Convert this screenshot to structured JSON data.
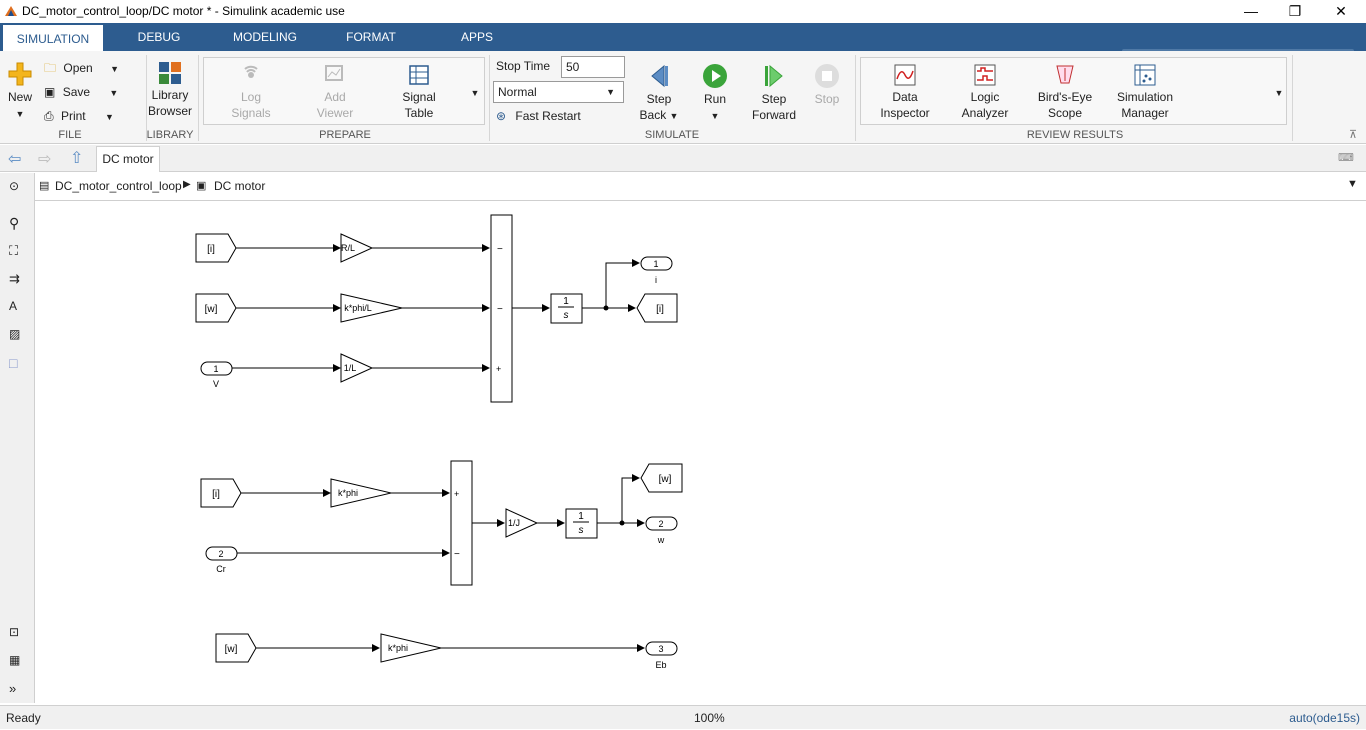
{
  "window": {
    "title": "DC_motor_control_loop/DC motor * - Simulink academic use",
    "minimize": "—",
    "restore": "❐",
    "close": "✕"
  },
  "tabs": [
    {
      "label": "SIMULATION"
    },
    {
      "label": "DEBUG"
    },
    {
      "label": "MODELING"
    },
    {
      "label": "FORMAT"
    },
    {
      "label": "APPS"
    }
  ],
  "ribbon": {
    "file": {
      "new_label": "New",
      "open_label": "Open",
      "save_label": "Save",
      "print_label": "Print",
      "section": "FILE"
    },
    "library": {
      "browser_line1": "Library",
      "browser_line2": "Browser",
      "section": "LIBRARY"
    },
    "prepare": {
      "log_line1": "Log",
      "log_line2": "Signals",
      "add_line1": "Add",
      "add_line2": "Viewer",
      "signal_line1": "Signal",
      "signal_line2": "Table",
      "section": "PREPARE"
    },
    "simulate": {
      "stop_time_label": "Stop Time",
      "stop_time_value": "50",
      "mode_value": "Normal",
      "fast_restart_label": "Fast Restart",
      "step_back_line1": "Step",
      "step_back_line2": "Back",
      "run_label": "Run",
      "step_forward_line1": "Step",
      "step_forward_line2": "Forward",
      "stop_label": "Stop",
      "section": "SIMULATE"
    },
    "review": {
      "data_line1": "Data",
      "data_line2": "Inspector",
      "logic_line1": "Logic",
      "logic_line2": "Analyzer",
      "birds_line1": "Bird's-Eye",
      "birds_line2": "Scope",
      "sim_line1": "Simulation",
      "sim_line2": "Manager",
      "section": "REVIEW RESULTS"
    }
  },
  "nav": {
    "doc_tab": "DC motor"
  },
  "breadcrumb": {
    "root": "DC_motor_control_loop",
    "child": "DC motor"
  },
  "diagram": {
    "goto_i_1": "[i]",
    "goto_w_1": "[w]",
    "inport_v_num": "1",
    "inport_v_name": "V",
    "gain_rl": "R/L",
    "gain_kphil": "k*phi/L",
    "gain_1l": "1/L",
    "sum1_sign1": "−",
    "sum1_sign2": "−",
    "sum1_sign3": "+",
    "integ_num": "1",
    "integ_den": "s",
    "outport_i_num": "1",
    "outport_i_name": "i",
    "goto_i_out": "[i]",
    "from_i_2": "[i]",
    "gain_kphi_2": "k*phi",
    "inport_cr_num": "2",
    "inport_cr_name": "Cr",
    "sum2_sign1": "+",
    "sum2_sign2": "−",
    "gain_1j": "1/J",
    "integ2_num": "1",
    "integ2_den": "s",
    "goto_w_out": "[w]",
    "outport_w_num": "2",
    "outport_w_name": "w",
    "from_w_3": "[w]",
    "gain_kphi_3": "k*phi",
    "outport_eb_num": "3",
    "outport_eb_name": "Eb"
  },
  "status": {
    "state": "Ready",
    "zoom": "100%",
    "solver": "auto(ode15s)"
  }
}
